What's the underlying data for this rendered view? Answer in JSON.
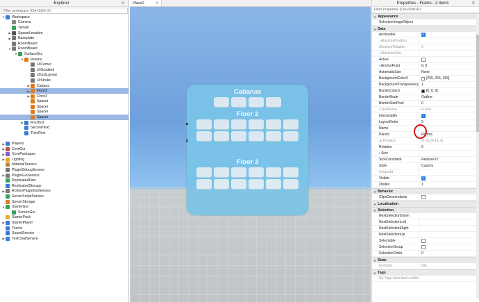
{
  "explorer": {
    "title": "Explorer",
    "filter_placeholder": "Filter workspace (Ctrl+Shift+X)",
    "items": [
      {
        "label": "Workspace",
        "indent": 0,
        "arrow": "open",
        "color": "#3a7bd5"
      },
      {
        "label": "Camera",
        "indent": 1,
        "arrow": "",
        "color": "#888"
      },
      {
        "label": "Terrain",
        "indent": 1,
        "arrow": "",
        "color": "#3aa05a"
      },
      {
        "label": "SpawnLocation",
        "indent": 1,
        "arrow": "closed",
        "color": "#555"
      },
      {
        "label": "Baseplate",
        "indent": 1,
        "arrow": "closed",
        "color": "#777"
      },
      {
        "label": "RoomBoard",
        "indent": 1,
        "arrow": "",
        "color": "#777"
      },
      {
        "label": "RoomBoard",
        "indent": 1,
        "arrow": "open",
        "color": "#777"
      },
      {
        "label": "SurfaceGui",
        "indent": 2,
        "arrow": "open",
        "color": "#3aa05a"
      },
      {
        "label": "Rooms",
        "indent": 3,
        "arrow": "open",
        "color": "#e07b1c"
      },
      {
        "label": "UICorner",
        "indent": 4,
        "arrow": "",
        "color": "#777"
      },
      {
        "label": "UIGradient",
        "indent": 4,
        "arrow": "",
        "color": "#777"
      },
      {
        "label": "UIListLayout",
        "indent": 4,
        "arrow": "",
        "color": "#777"
      },
      {
        "label": "UIStroke",
        "indent": 4,
        "arrow": "",
        "color": "#777"
      },
      {
        "label": "Cabana",
        "indent": 4,
        "arrow": "closed",
        "color": "#e07b1c"
      },
      {
        "label": "Floor2",
        "indent": 4,
        "arrow": "closed",
        "color": "#e07b1c",
        "selected": true
      },
      {
        "label": "Floor3",
        "indent": 4,
        "arrow": "closed",
        "color": "#e07b1c"
      },
      {
        "label": "Spacer",
        "indent": 4,
        "arrow": "",
        "color": "#e07b1c"
      },
      {
        "label": "Spacer",
        "indent": 4,
        "arrow": "",
        "color": "#e07b1c"
      },
      {
        "label": "Spacer",
        "indent": 4,
        "arrow": "",
        "color": "#e07b1c"
      },
      {
        "label": "Spacer",
        "indent": 4,
        "arrow": "",
        "color": "#e07b1c",
        "selected": true
      },
      {
        "label": "FirstText",
        "indent": 3,
        "arrow": "closed",
        "color": "#3a7bd5"
      },
      {
        "label": "SecondText",
        "indent": 3,
        "arrow": "",
        "color": "#3a7bd5"
      },
      {
        "label": "ThirdText",
        "indent": 3,
        "arrow": "",
        "color": "#3a7bd5"
      },
      {
        "label": "",
        "indent": 0,
        "arrow": "",
        "color": ""
      },
      {
        "label": "Players",
        "indent": 0,
        "arrow": "closed",
        "color": "#3a7bd5"
      },
      {
        "label": "CoreGui",
        "indent": 0,
        "arrow": "closed",
        "color": "#c05050"
      },
      {
        "label": "CorePackages",
        "indent": 0,
        "arrow": "closed",
        "color": "#8060c0"
      },
      {
        "label": "Lighting",
        "indent": 0,
        "arrow": "closed",
        "color": "#e0b020"
      },
      {
        "label": "MaterialService",
        "indent": 0,
        "arrow": "",
        "color": "#c08040"
      },
      {
        "label": "PluginDebugService",
        "indent": 0,
        "arrow": "",
        "color": "#777"
      },
      {
        "label": "PluginGuiService",
        "indent": 0,
        "arrow": "closed",
        "color": "#777"
      },
      {
        "label": "ReplicatedFirst",
        "indent": 0,
        "arrow": "",
        "color": "#3aa05a"
      },
      {
        "label": "ReplicatedStorage",
        "indent": 0,
        "arrow": "",
        "color": "#3a7bd5"
      },
      {
        "label": "RobloxPluginGuiService",
        "indent": 0,
        "arrow": "closed",
        "color": "#777"
      },
      {
        "label": "ServerScriptService",
        "indent": 0,
        "arrow": "",
        "color": "#3aa05a"
      },
      {
        "label": "ServerStorage",
        "indent": 0,
        "arrow": "",
        "color": "#e07b1c"
      },
      {
        "label": "StarterGui",
        "indent": 0,
        "arrow": "open",
        "color": "#3aa05a"
      },
      {
        "label": "ScreenGui",
        "indent": 1,
        "arrow": "",
        "color": "#3aa05a"
      },
      {
        "label": "StarterPack",
        "indent": 0,
        "arrow": "",
        "color": "#e0b020"
      },
      {
        "label": "StarterPlayer",
        "indent": 0,
        "arrow": "closed",
        "color": "#3a7bd5"
      },
      {
        "label": "Teams",
        "indent": 0,
        "arrow": "",
        "color": "#3a7bd5"
      },
      {
        "label": "SoundService",
        "indent": 0,
        "arrow": "",
        "color": "#3a7bd5"
      },
      {
        "label": "TextChatService",
        "indent": 0,
        "arrow": "closed",
        "color": "#3a7bd5"
      }
    ]
  },
  "viewport": {
    "tab_label": "Place2",
    "sections": [
      {
        "title": "Cabanas",
        "rows": [
          4
        ]
      },
      {
        "title": "Floor 2",
        "rows": [
          6,
          6
        ]
      },
      {
        "title": "Floor 3",
        "rows": [
          6,
          6
        ]
      }
    ]
  },
  "properties": {
    "title": "Properties - Frame - 2 items",
    "filter_placeholder": "Filter Properties (Ctrl+Shift+P)",
    "rows": [
      {
        "kind": "section",
        "name": "Appearance"
      },
      {
        "name": "SelectionImageObject",
        "value": ""
      },
      {
        "kind": "section",
        "name": "Data"
      },
      {
        "name": "Archivable",
        "check": true
      },
      {
        "name": "AbsolutePosition",
        "value": "",
        "dim": true,
        "arrow": true
      },
      {
        "name": "AbsoluteRotation",
        "value": "0",
        "dim": true
      },
      {
        "name": "AbsoluteSize",
        "value": "",
        "dim": true,
        "arrow": true
      },
      {
        "name": "Active",
        "check": false
      },
      {
        "name": "AnchorPoint",
        "value": "0, 0",
        "arrow": true
      },
      {
        "name": "AutomaticSize",
        "value": "None"
      },
      {
        "name": "BackgroundColor3",
        "value": "[255, 255, 255]",
        "swatch": "#ffffff"
      },
      {
        "name": "BackgroundTransparency",
        "value": "1"
      },
      {
        "name": "BorderColor3",
        "value": "[0, 0, 0]",
        "swatch": "#000000"
      },
      {
        "name": "BorderMode",
        "value": "Outline"
      },
      {
        "name": "BorderSizePixel",
        "value": "0"
      },
      {
        "name": "ClassName",
        "value": "Frame",
        "dim": true
      },
      {
        "name": "Interactable",
        "check": true
      },
      {
        "name": "LayoutOrder",
        "value": "5"
      },
      {
        "name": "Name",
        "value": ""
      },
      {
        "name": "Parent",
        "value": "Rooms"
      },
      {
        "name": "Position",
        "value": "{0, 0},{0.43, 0}",
        "dim": true,
        "warn": true,
        "arrow": true
      },
      {
        "name": "Rotation",
        "value": "0"
      },
      {
        "name": "Size",
        "value": "",
        "arrow": true
      },
      {
        "name": "SizeConstraint",
        "value": "RelativeXY"
      },
      {
        "name": "Style",
        "value": "Custom"
      },
      {
        "name": "UniqueId",
        "value": "",
        "dim": true
      },
      {
        "name": "Visible",
        "check": true
      },
      {
        "name": "ZIndex",
        "value": "1"
      },
      {
        "kind": "section",
        "name": "Behavior"
      },
      {
        "name": "ClipsDescendants",
        "check": false
      },
      {
        "kind": "section",
        "name": "Localization"
      },
      {
        "kind": "section",
        "name": "Selection"
      },
      {
        "name": "NextSelectionDown",
        "value": ""
      },
      {
        "name": "NextSelectionLeft",
        "value": ""
      },
      {
        "name": "NextSelectionRight",
        "value": ""
      },
      {
        "name": "NextSelectionUp",
        "value": ""
      },
      {
        "name": "Selectable",
        "check": false
      },
      {
        "name": "SelectionGroup",
        "check": false
      },
      {
        "name": "SelectionOrder",
        "value": "0"
      },
      {
        "kind": "section",
        "name": "State"
      },
      {
        "name": "GuiState",
        "value": "Idle",
        "dim": true
      },
      {
        "kind": "section",
        "name": "Tags"
      },
      {
        "name": "No Tags have been added yet",
        "value": "",
        "dim": true
      }
    ]
  }
}
